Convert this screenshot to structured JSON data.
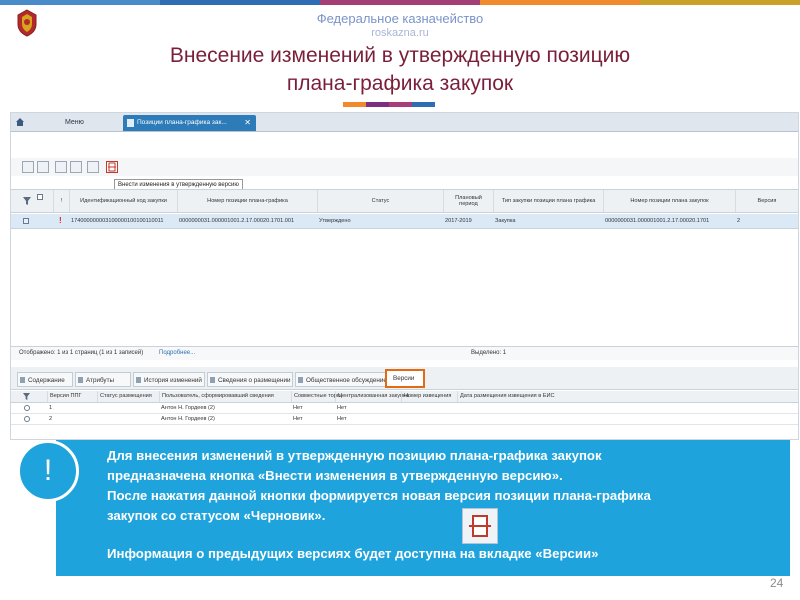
{
  "header": {
    "org_name": "Федеральное казначейство",
    "org_site": "roskazna.ru",
    "title_line1": "Внесение изменений в утвержденную позицию",
    "title_line2": "плана-графика закупок"
  },
  "colors": {
    "title": "#7a1f3b",
    "info_panel": "#1fa3dc",
    "top_strip": [
      "#4a8cc9",
      "#2e6db3",
      "#a33e77",
      "#f08a2d",
      "#c9a227"
    ],
    "accent_line": [
      "#f08a2d",
      "#7a2f80",
      "#a83d78",
      "#2e6db3"
    ],
    "active_tab": "#2d7bb8",
    "selected_tab_border": "#e06b14"
  },
  "app": {
    "tabs": {
      "menu": "Меню",
      "position": "Позиции плана-графика зак...",
      "close": "✕"
    },
    "tooltip": "Внести изменения в утвержденную версию",
    "grid": {
      "headers": {
        "flag": "!",
        "ikz": "Идентификационный код закупки",
        "position_no": "Номер позиции плана-графика",
        "status": "Статус",
        "period": "Плановый период",
        "type": "Тип закупки позиции плана графика",
        "pos_no_full": "Номер позиции плана закупок",
        "version": "Версия"
      },
      "row": {
        "flag": "!",
        "ikz": "174000000003100000100100110011",
        "position_no": "0000000031.000001001.2.17.00020.1701.001",
        "status": "Утверждено",
        "period": "2017-2019",
        "type": "Закупка",
        "pos_no_full": "0000000031.000001001.2.17.00020.1701",
        "version": "2"
      }
    },
    "status_bar": {
      "shown": "Отображено: 1 из 1 страниц (1 из 1 записей)",
      "more": "Подробнее...",
      "selected": "Выделено: 1"
    },
    "bottom_tabs": [
      "Содержание",
      "Атрибуты",
      "История изменений",
      "Сведения о размещении",
      "Общественное обсуждение",
      "Версии"
    ],
    "versions_table": {
      "headers": [
        "Версия ППГ",
        "Статус размещения",
        "Пользователь, сформировавший сведения",
        "Совместные торги",
        "Централизованная закупка",
        "Номер извещения",
        "Дата размещения извещения в ЕИС"
      ],
      "rows": [
        {
          "version": "1",
          "status": "",
          "user": "Антон Н. Гордеев (2)",
          "joint": "Нет",
          "central": "Нет",
          "notice": "",
          "date": ""
        },
        {
          "version": "2",
          "status": "",
          "user": "Антон Н. Гордеев (2)",
          "joint": "Нет",
          "central": "Нет",
          "notice": "",
          "date": ""
        }
      ]
    }
  },
  "info": {
    "mark": "!",
    "line1": "Для внесения изменений в утвержденную позицию плана-графика закупок",
    "line2": "предназначена кнопка «Внести изменения в утвержденную версию».",
    "line3": "После нажатия данной кнопки формируется новая версия позиции плана-графика",
    "line4": "закупок со статусом «Черновик».",
    "line5": "Информация о  предыдущих версиях будет доступна на вкладке «Версии»"
  },
  "page_number": "24"
}
